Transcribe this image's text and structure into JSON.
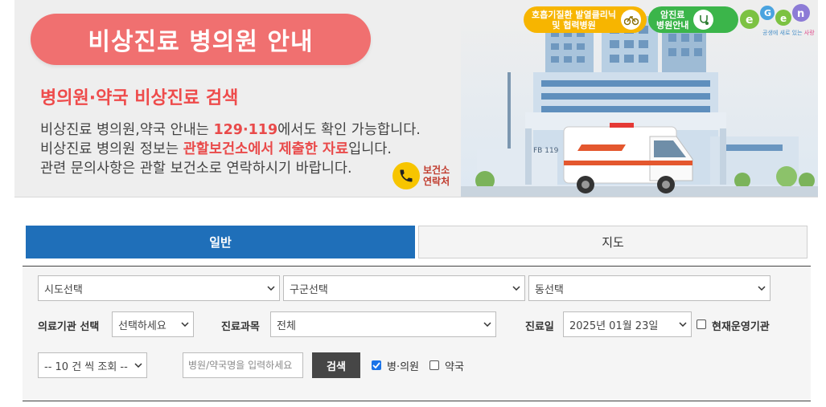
{
  "banner": {
    "title": "비상진료 병의원 안내",
    "subtitle": "병의원·약국 비상진료 검색",
    "line1_pre": "비상진료 병의원,약국 안내는 ",
    "line1_hl": "129·119",
    "line1_post": "에서도 확인 가능합니다.",
    "line2_pre": "비상진료 병의원 정보는 ",
    "line2_hl": "관할보건소에서 제출한 자료",
    "line2_post": "입니다.",
    "line3": "관련 문의사항은 관할 보건소로 연락하시기 바랍니다.",
    "contact_line1": "보건소",
    "contact_line2": "연락처",
    "badge_clinic_1": "호흡기질환 발열클리닉",
    "badge_clinic_2": "및 협력병원",
    "badge_cancer_1": "암진료",
    "badge_cancer_2": "병원안내",
    "logo_sub_a": "공생에 새로 있는 ",
    "logo_sub_b": "사랑",
    "building_sign": "FB 119"
  },
  "tabs": {
    "general": "일반",
    "map": "지도"
  },
  "search": {
    "sido": "시도선택",
    "gugun": "구군선택",
    "dong": "동선택",
    "institution_label": "의료기관 선택",
    "institution_value": "선택하세요",
    "dept_label": "진료과목",
    "dept_value": "전체",
    "date_label": "진료일",
    "date_value": "2025년 01월 23일",
    "operating_label": "현재운영기관",
    "page_size": "-- 10 건 씩 조회 --",
    "name_placeholder": "병원/약국명을 입력하세요",
    "search_button": "검색",
    "hospital_label": "병·의원",
    "pharmacy_label": "약국"
  },
  "state": {
    "operating_checked": false,
    "hospital_checked": true,
    "pharmacy_checked": false
  },
  "colors": {
    "title_pill": "#f07070",
    "highlight": "#e94a4a",
    "active_tab": "#1f6fb9",
    "badge_yellow": "#f7b500",
    "badge_green": "#3bb54a"
  }
}
